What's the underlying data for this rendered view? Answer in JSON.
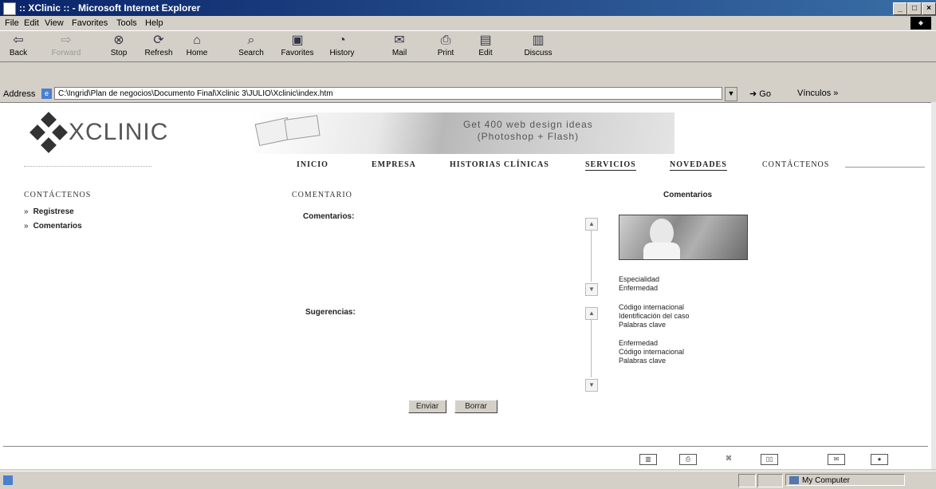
{
  "window": {
    "title": ":: XClinic :: - Microsoft Internet Explorer",
    "controls": [
      "_",
      "□",
      "×"
    ]
  },
  "menu": [
    "File",
    "Edit",
    "View",
    "Favorites",
    "Tools",
    "Help"
  ],
  "toolbar": {
    "back": "Back",
    "forward": "Forward",
    "stop": "Stop",
    "refresh": "Refresh",
    "home": "Home",
    "search": "Search",
    "favorites": "Favorites",
    "history": "History",
    "mail": "Mail",
    "print": "Print",
    "edit": "Edit",
    "discuss": "Discuss"
  },
  "address": {
    "label": "Address",
    "value": "C:\\Ingrid\\Plan de negocios\\Documento Final\\Xclinic 3\\JULIO\\Xclinic\\index.htm",
    "go": "Go",
    "links": "Vínculos »"
  },
  "logo": {
    "text": "XCLINIC"
  },
  "banner": {
    "line1": "Get 400 web design ideas",
    "line2": "(Photoshop + Flash)"
  },
  "nav": {
    "inicio": "INICIO",
    "empresa": "EMPRESA",
    "historias": "HISTORIAS CLÍNICAS",
    "servicios": "SERVICIOS",
    "novedades": "NOVEDADES",
    "contactenos": "CONTÁCTENOS"
  },
  "sidebar": {
    "heading": "CONTÁCTENOS",
    "items": [
      {
        "arrow": "»",
        "label": "Registrese"
      },
      {
        "arrow": "»",
        "label": "Comentarios"
      }
    ]
  },
  "form": {
    "heading": "COMENTARIO",
    "comentarios_label": "Comentarios:",
    "sugerencias_label": "Sugerencias:",
    "submit": "Enviar",
    "reset": "Borrar"
  },
  "right_panel": {
    "heading": "Comentarios",
    "group1": [
      "Especialidad",
      "Enfermedad"
    ],
    "group2": [
      "Código internacional",
      "Identificación del caso",
      "Palabras clave"
    ],
    "group3": [
      "Enfermedad",
      "Código internacional",
      "Palabras clave"
    ]
  },
  "status": {
    "zone": "My Computer"
  }
}
